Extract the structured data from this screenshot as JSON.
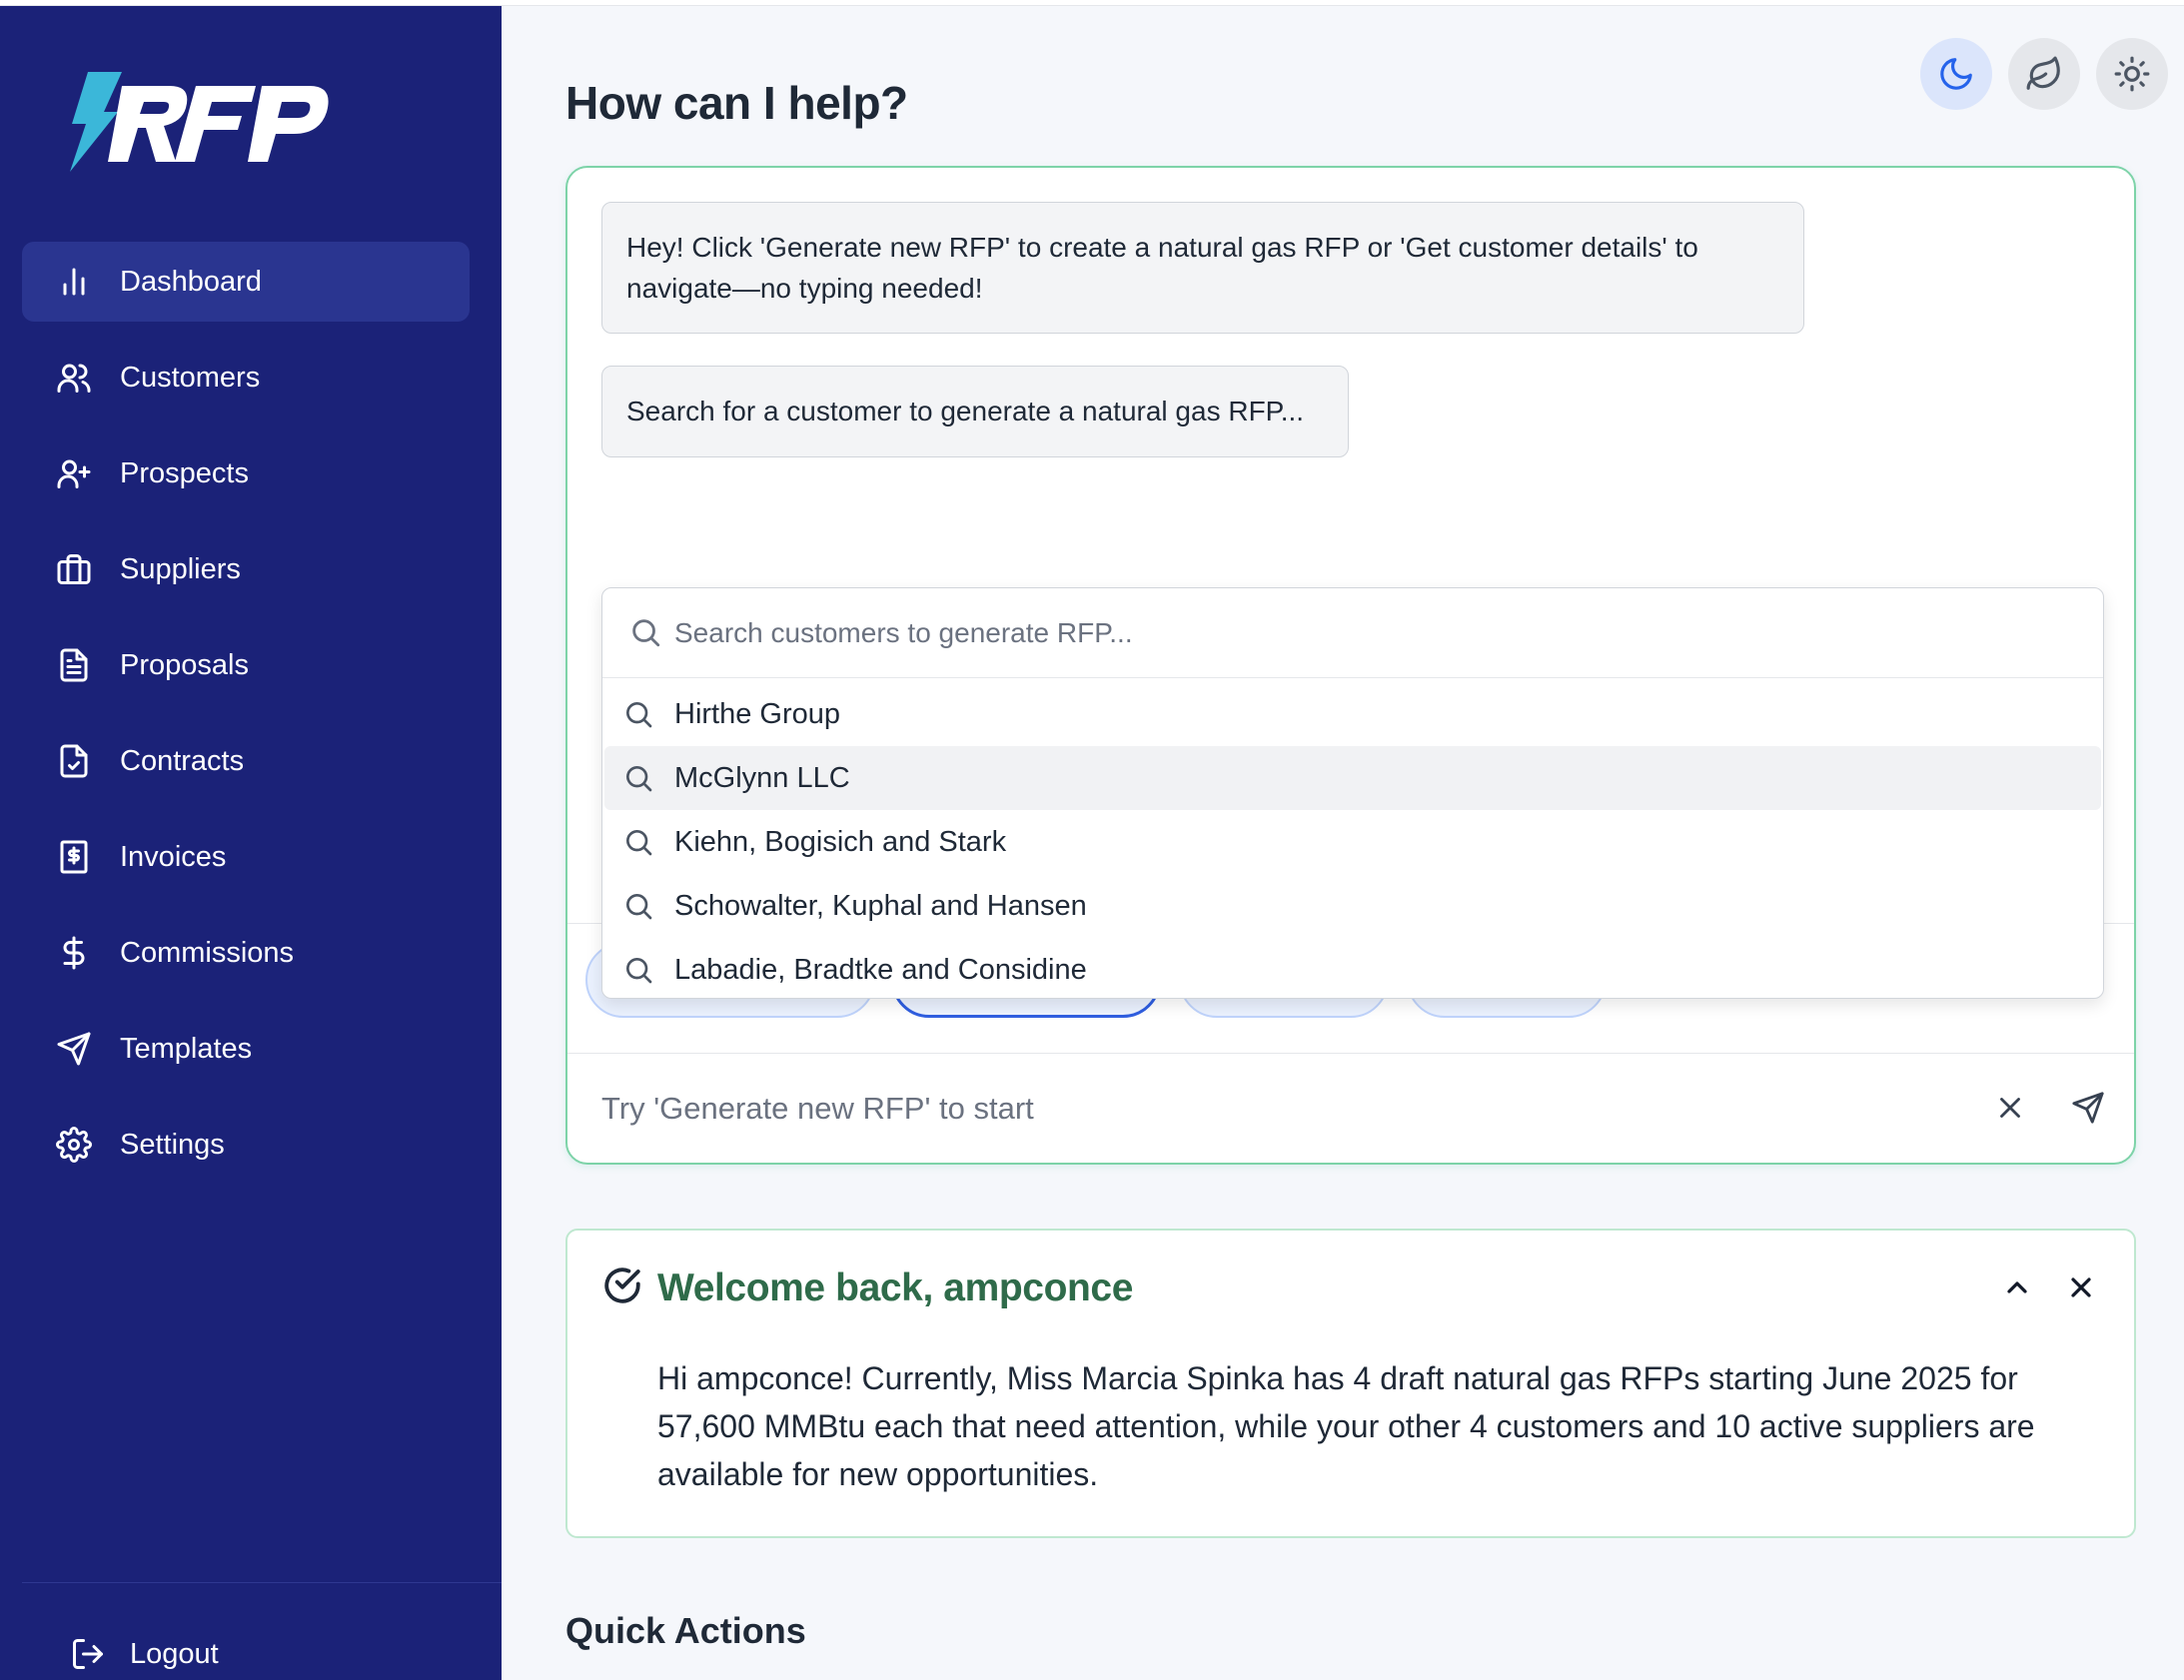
{
  "app": {
    "logo_text": "RFP",
    "brand_colors": {
      "sidebar": "#1b2278",
      "logo_bolt": "#3bb7d9",
      "accent_green": "#2f6b4a"
    }
  },
  "sidebar": {
    "items": [
      {
        "label": "Dashboard",
        "icon": "bar-chart-icon",
        "active": true
      },
      {
        "label": "Customers",
        "icon": "users-icon"
      },
      {
        "label": "Prospects",
        "icon": "user-plus-icon"
      },
      {
        "label": "Suppliers",
        "icon": "briefcase-icon"
      },
      {
        "label": "Proposals",
        "icon": "file-text-icon"
      },
      {
        "label": "Contracts",
        "icon": "file-check-icon"
      },
      {
        "label": "Invoices",
        "icon": "receipt-icon"
      },
      {
        "label": "Commissions",
        "icon": "dollar-icon"
      },
      {
        "label": "Templates",
        "icon": "send-icon"
      },
      {
        "label": "Settings",
        "icon": "gear-icon"
      }
    ],
    "logout_label": "Logout"
  },
  "header": {
    "title": "How can I help?",
    "theme_buttons": [
      "moon-icon",
      "leaf-icon",
      "sun-icon"
    ]
  },
  "chat": {
    "messages": [
      "Hey! Click 'Generate new RFP' to create a natural gas RFP or 'Get customer details' to navigate—no typing needed!",
      "Search for a customer to generate a natural gas RFP..."
    ],
    "dropdown": {
      "search_placeholder": "Search customers to generate RFP...",
      "items": [
        "Hirthe Group",
        "McGlynn LLC",
        "Kiehn, Bogisich and Stark",
        "Schowalter, Kuphal and Hansen",
        "Labadie, Bradtke and Considine"
      ]
    },
    "input_placeholder": "Try 'Generate new RFP' to start"
  },
  "welcome": {
    "title": "Welcome back, ampconce",
    "body": "Hi ampconce! Currently, Miss Marcia Spinka has 4 draft natural gas RFPs starting June 2025 for 57,600 MMBtu each that need attention, while your other 4 customers and 10 active suppliers are available for new opportunities."
  },
  "quick_actions": {
    "title": "Quick Actions"
  }
}
